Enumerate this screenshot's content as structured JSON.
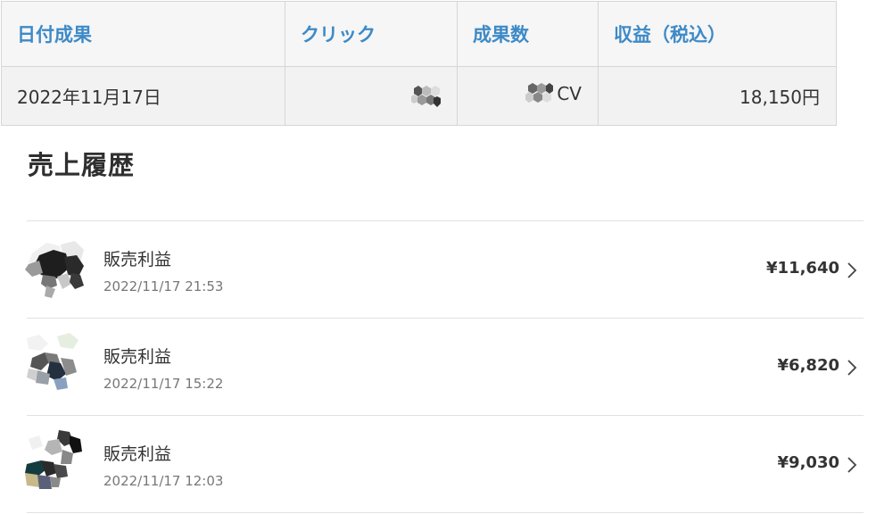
{
  "report": {
    "headers": {
      "date": "日付成果",
      "clicks": "クリック",
      "conversions": "成果数",
      "revenue": "収益（税込）"
    },
    "row": {
      "date": "2022年11月17日",
      "clicks": "",
      "conversions_unit": "CV",
      "revenue": "18,150円"
    }
  },
  "history": {
    "title": "売上履歴",
    "items": [
      {
        "label": "販売利益",
        "datetime": "2022/11/17 21:53",
        "amount": "¥11,640"
      },
      {
        "label": "販売利益",
        "datetime": "2022/11/17 15:22",
        "amount": "¥6,820"
      },
      {
        "label": "販売利益",
        "datetime": "2022/11/17 12:03",
        "amount": "¥9,030"
      }
    ]
  }
}
